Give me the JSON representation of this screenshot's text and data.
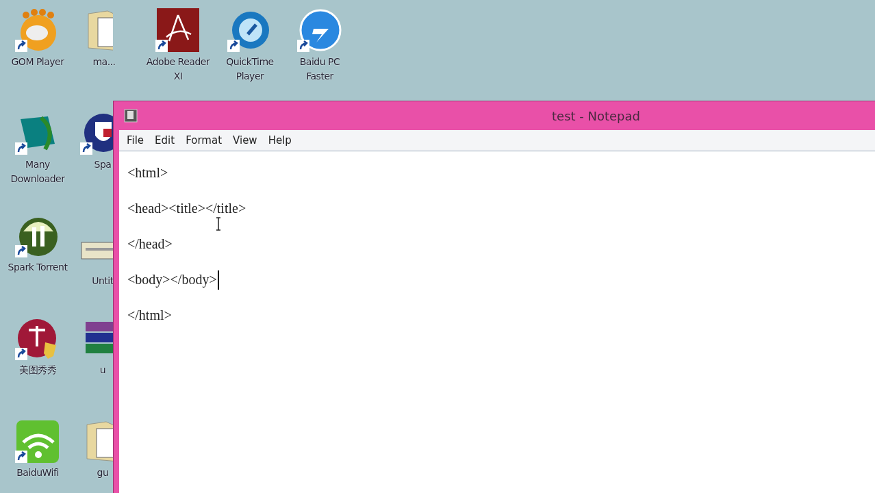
{
  "desktop_icons": [
    {
      "label": "GOM Player",
      "kind": "gom",
      "shortcut": true
    },
    {
      "label": "ma...",
      "kind": "folder",
      "shortcut": false
    },
    {
      "label": "Adobe Reader XI",
      "kind": "pdf",
      "shortcut": true
    },
    {
      "label": "QuickTime Player",
      "kind": "quicktime",
      "shortcut": true
    },
    {
      "label": "Baidu PC Faster",
      "kind": "baidu",
      "shortcut": true
    },
    {
      "label": "Many Downloader",
      "kind": "downloader",
      "shortcut": true
    },
    {
      "label": "Spa",
      "kind": "shield",
      "shortcut": true
    },
    {
      "label": "Spark Torrent",
      "kind": "torrent",
      "shortcut": true
    },
    {
      "label": "Untit",
      "kind": "keyboard",
      "shortcut": false
    },
    {
      "label": "美图秀秀",
      "kind": "meitu",
      "shortcut": true
    },
    {
      "label": "u",
      "kind": "archive",
      "shortcut": false
    },
    {
      "label": "BaiduWifi",
      "kind": "wifi",
      "shortcut": true
    },
    {
      "label": "gu",
      "kind": "folder",
      "shortcut": false
    }
  ],
  "window": {
    "title": "test - Notepad",
    "menu": [
      "File",
      "Edit",
      "Format",
      "View",
      "Help"
    ],
    "lines": [
      {
        "text": "<html>",
        "caret": false
      },
      {
        "text": "<head><title></title>",
        "caret": false
      },
      {
        "text": "</head>",
        "caret": false
      },
      {
        "text": "<body></body>",
        "caret": true
      },
      {
        "text": "</html>",
        "caret": false
      }
    ]
  }
}
